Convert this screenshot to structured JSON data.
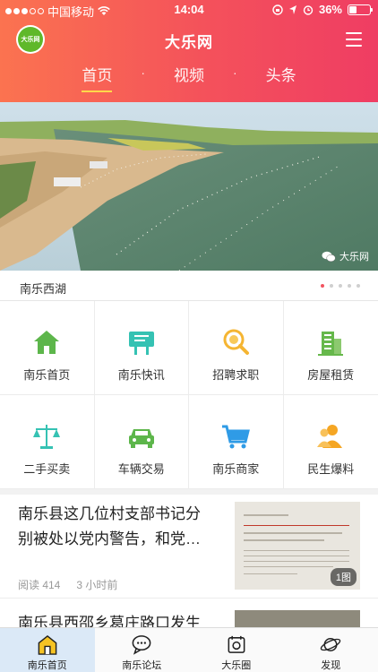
{
  "status_bar": {
    "carrier": "中国移动",
    "time": "14:04",
    "battery": "36%",
    "battery_level": 0.36
  },
  "header": {
    "logo_text": "大乐网",
    "title": "大乐网",
    "tabs": [
      {
        "label": "首页",
        "active": true
      },
      {
        "label": "视频",
        "active": false
      },
      {
        "label": "头条",
        "active": false
      }
    ],
    "tab_separator": "·"
  },
  "banner": {
    "watermark": "大乐网",
    "caption": "南乐西湖",
    "page_count": 5,
    "active_page": 1
  },
  "grid": [
    {
      "label": "南乐首页",
      "icon": "house-icon",
      "color": "#5db64b"
    },
    {
      "label": "南乐快讯",
      "icon": "billboard-icon",
      "color": "#35c2b3"
    },
    {
      "label": "招聘求职",
      "icon": "job-search-icon",
      "color": "#f5b532"
    },
    {
      "label": "房屋租赁",
      "icon": "building-icon",
      "color": "#66b84b"
    },
    {
      "label": "二手买卖",
      "icon": "scale-icon",
      "color": "#35c2b3"
    },
    {
      "label": "车辆交易",
      "icon": "car-icon",
      "color": "#5db64b"
    },
    {
      "label": "南乐商家",
      "icon": "cart-icon",
      "color": "#2f9be6"
    },
    {
      "label": "民生爆料",
      "icon": "people-icon",
      "color": "#f5a623"
    }
  ],
  "news": [
    {
      "title": "南乐县这几位村支部书记分别被处以党内警告，和党…",
      "reads": "阅读 414",
      "time": "3 小时前",
      "thumb_badge": "1图"
    },
    {
      "title": "南乐县西邵乡葛庄路口发生"
    }
  ],
  "tabbar": [
    {
      "label": "南乐首页",
      "icon": "home-badge-icon",
      "active": true
    },
    {
      "label": "南乐论坛",
      "icon": "chat-bubble-icon",
      "active": false
    },
    {
      "label": "大乐圈",
      "icon": "circle-card-icon",
      "active": false
    },
    {
      "label": "发现",
      "icon": "planet-icon",
      "active": false
    }
  ]
}
